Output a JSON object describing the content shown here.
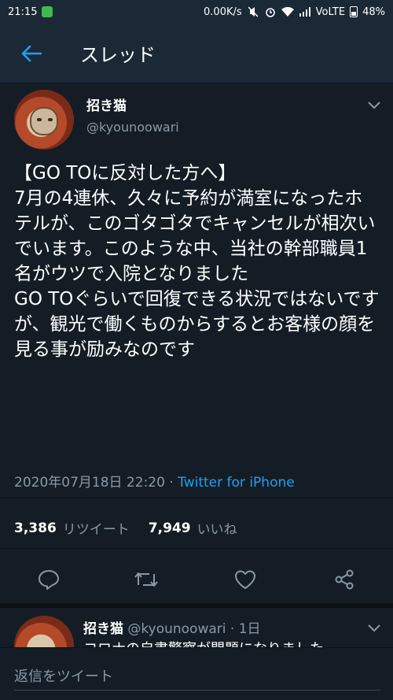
{
  "status_bar": {
    "time": "21:15",
    "net_speed": "0.00K/s",
    "volte": "VoLTE",
    "battery": "48%"
  },
  "header": {
    "title": "スレッド"
  },
  "tweet": {
    "name": "招き猫",
    "handle": "@kyounoowari",
    "text": "【GO TOに反対した方へ】\n7月の4連休、久々に予約が満室になったホテルが、このゴタゴタでキャンセルが相次いでいます。このような中、当社の幹部職員1名がウツで入院となりました\nGO TOぐらいで回復できる状況ではないですが、観光で働くものからするとお客様の顔を見る事が励みなのです",
    "timestamp": "2020年07月18日 22:20",
    "separator": " · ",
    "via": "Twitter for iPhone",
    "retweet_count": "3,386",
    "retweet_label": "リツイート",
    "like_count": "7,949",
    "like_label": "いいね"
  },
  "reply": {
    "name": "招き猫",
    "handle_time": "@kyounoowari · 1日",
    "text": "コロナの自粛警察が問題になりました"
  },
  "composer": {
    "placeholder": "返信をツイート"
  },
  "colors": {
    "background": "#141d26",
    "bar": "#1b2836",
    "accent": "#1da1f2",
    "secondary_text": "#8899a6"
  },
  "icons": [
    "back-arrow-icon",
    "chevron-down-icon",
    "reply-icon",
    "retweet-icon",
    "like-icon",
    "share-icon"
  ]
}
